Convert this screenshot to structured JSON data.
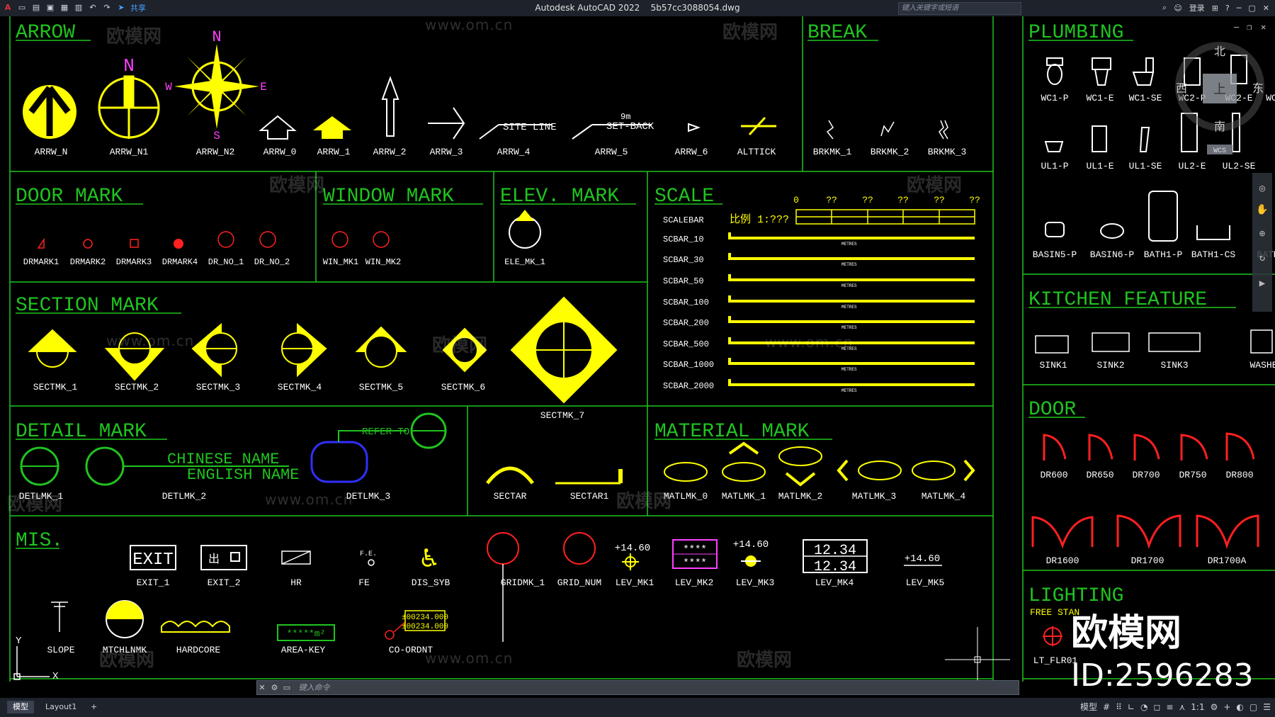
{
  "app": {
    "title": "Autodesk AutoCAD 2022",
    "filename": "5b57cc3088054.dwg",
    "search_placeholder": "键入关键字或短语",
    "login": "登录",
    "share": "共享"
  },
  "cmd": {
    "placeholder": "键入命令"
  },
  "status": {
    "tabs": [
      "模型",
      "Layout1",
      "+"
    ],
    "model_label": "模型",
    "scale": "1:1"
  },
  "viewcube": {
    "n": "北",
    "s": "南",
    "e": "东",
    "w": "西",
    "top": "上",
    "wcs": "WCS"
  },
  "watermark": {
    "brand": "欧模网",
    "url": "www.om.cn",
    "id": "ID:2596283"
  },
  "colors": {
    "green": "#1fc41f",
    "yellow": "#ffff00",
    "white": "#ffffff",
    "red": "#ff2020",
    "magenta": "#ff40ff",
    "blue": "#3030ff"
  },
  "sections": {
    "arrow": "ARROW",
    "break": "BREAK",
    "plumbing": "PLUMBING",
    "door_mark": "DOOR MARK",
    "window_mark": "WINDOW MARK",
    "elev_mark": "ELEV. MARK",
    "scale": "SCALE",
    "section_mark": "SECTION MARK",
    "kitchen": "KITCHEN FEATURE",
    "door": "DOOR",
    "detail_mark": "DETAIL MARK",
    "material_mark": "MATERIAL MARK",
    "mis": "MIS.",
    "lighting": "LIGHTING"
  },
  "arrow_labels": [
    "ARRW_N",
    "ARRW_N1",
    "ARRW_N2",
    "ARRW_0",
    "ARRW_1",
    "ARRW_2",
    "ARRW_3",
    "ARRW_4",
    "ARRW_5",
    "ARRW_6",
    "ALTTICK"
  ],
  "arrow_text": {
    "n": "N",
    "w": "W",
    "e": "E",
    "s": "S",
    "site": "SITE LINE",
    "setback": "SET-BACK",
    "nine_m": "9m"
  },
  "break_labels": [
    "BRKMK_1",
    "BRKMK_2",
    "BRKMK_3"
  ],
  "plumbing_row1": [
    "WC1-P",
    "WC1-E",
    "WC1-SE",
    "WC2-P",
    "WC2-E",
    "WC"
  ],
  "plumbing_row2": [
    "UL1-P",
    "UL1-E",
    "UL1-SE",
    "UL2-E",
    "UL2-SE"
  ],
  "plumbing_row3": [
    "BASIN5-P",
    "BASIN6-P",
    "BATH1-P",
    "BATH1-CS",
    "BATH"
  ],
  "door_mark_labels": [
    "DRMARK1",
    "DRMARK2",
    "DRMARK3",
    "DRMARK4",
    "DR_NO_1",
    "DR_NO_2"
  ],
  "window_mark_labels": [
    "WIN_MK1",
    "WIN_MK2"
  ],
  "elev_labels": [
    "ELE_MK_1"
  ],
  "scale": {
    "ratio": "比例 1:???",
    "ticks": [
      "0",
      "??",
      "??",
      "??",
      "??",
      "??"
    ],
    "bars": [
      "SCALEBAR",
      "SCBAR_10",
      "SCBAR_30",
      "SCBAR_50",
      "SCBAR_100",
      "SCBAR_200",
      "SCBAR_500",
      "SCBAR_1000",
      "SCBAR_2000"
    ],
    "metres": "METRES"
  },
  "section_labels": [
    "SECTMK_1",
    "SECTMK_2",
    "SECTMK_3",
    "SECTMK_4",
    "SECTMK_5",
    "SECTMK_6",
    "SECTMK_7"
  ],
  "kitchen_labels": [
    "SINK1",
    "SINK2",
    "SINK3",
    "WASHE"
  ],
  "door_labels_row1": [
    "DR600",
    "DR650",
    "DR700",
    "DR750",
    "DR800"
  ],
  "door_labels_row2": [
    "DR1600",
    "DR1700",
    "DR1700A"
  ],
  "detail": {
    "labels": [
      "DETLMK_1",
      "DETLMK_2",
      "DETLMK_3",
      "SECTAR",
      "SECTAR1"
    ],
    "chinese": "CHINESE NAME",
    "english": "ENGLISH NAME",
    "refer": "REFER TO",
    "stars": "***"
  },
  "material_labels": [
    "MATLMK_0",
    "MATLMK_1",
    "MATLMK_2",
    "MATLMK_3",
    "MATLMK_4"
  ],
  "mis": {
    "labels_row1": [
      "EXIT_1",
      "EXIT_2",
      "HR",
      "FE",
      "DIS_SYB",
      "GRIDMK_1",
      "GRID_NUM",
      "LEV_MK1",
      "LEV_MK2",
      "LEV_MK3",
      "LEV_MK4",
      "LEV_MK5"
    ],
    "labels_row2": [
      "SLOPE",
      "MTCHLNMK",
      "HARDCORE",
      "AREA-KEY",
      "CO-ORDNT"
    ],
    "exit": "EXIT",
    "exit_cn": "出",
    "fe": "F.E.",
    "lev1": "+14.60",
    "lev3": "+14.60",
    "lev5": "+14.60",
    "lev4a": "12.34",
    "lev4b": "12.34",
    "lev2": "****",
    "area": "*****m²",
    "coord1": "±00234.000",
    "coord2": "±00234.000"
  },
  "lighting": {
    "sub": "FREE STAN",
    "label": "LT_FLR01"
  }
}
